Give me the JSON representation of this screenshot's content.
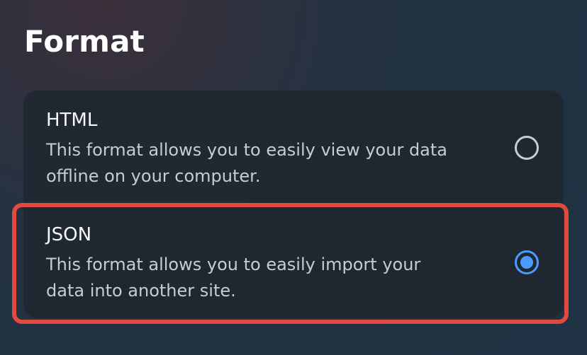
{
  "page": {
    "title": "Format"
  },
  "options": [
    {
      "label": "HTML",
      "description": "This format allows you to easily view your data\noffline on your computer.",
      "selected": false
    },
    {
      "label": "JSON",
      "description": "This format allows you to easily import your\ndata into another site.",
      "selected": true
    }
  ],
  "colors": {
    "accent": "#4b9bff",
    "selection_outline": "#e24a3f",
    "panel": "#1f2730"
  }
}
